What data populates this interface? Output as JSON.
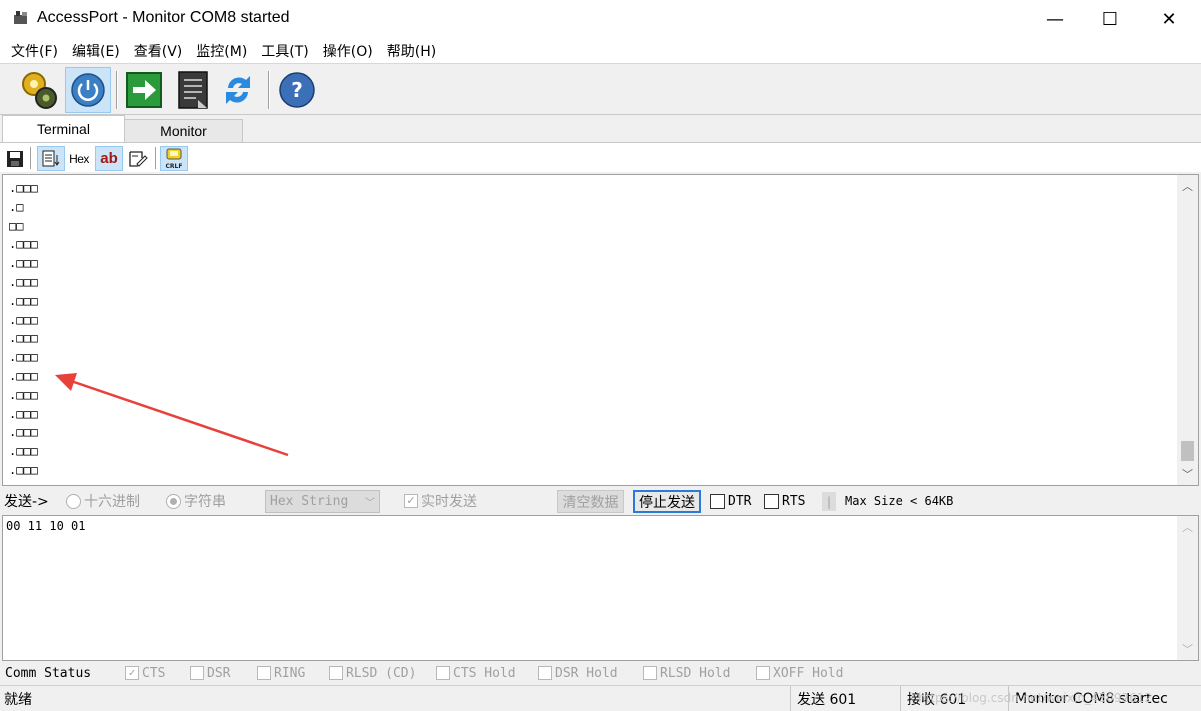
{
  "window": {
    "title": "AccessPort - Monitor COM8 started",
    "minimize_glyph": "—",
    "maximize_glyph": "☐",
    "close_glyph": "✕"
  },
  "menu": [
    "文件(F)",
    "编辑(E)",
    "查看(V)",
    "监控(M)",
    "工具(T)",
    "操作(O)",
    "帮助(H)"
  ],
  "toolbar": {
    "buttons": [
      "settings-gear-icon",
      "power-icon",
      "go-arrow-icon",
      "log-document-icon",
      "refresh-arrows-icon",
      "help-icon"
    ]
  },
  "tabs": {
    "terminal": "Terminal",
    "monitor": "Monitor"
  },
  "subtoolbar": {
    "hex_label": "Hex",
    "ab_label": "ab",
    "crlf_label": "CRLF"
  },
  "terminal": {
    "lines": [
      ".□□□",
      ".□",
      "□□",
      ".□□□",
      ".□□□",
      ".□□□",
      ".□□□",
      ".□□□",
      ".□□□",
      ".□□□",
      ".□□□",
      ".□□□",
      ".□□□",
      ".□□□",
      ".□□□",
      ".□□□"
    ]
  },
  "sendbar": {
    "label": "发送->",
    "radio_hex": "十六进制",
    "radio_string": "字符串",
    "format_select": "Hex String",
    "realtime_send": "实时发送",
    "clear_button": "清空数据",
    "stop_button": "停止发送",
    "dtr": "DTR",
    "rts": "RTS",
    "separator": "|",
    "max_size": "Max Size < 64KB"
  },
  "input": {
    "value": "00 11 10 01"
  },
  "comm_status": {
    "label": "Comm Status",
    "flags": [
      "CTS",
      "DSR",
      "RING",
      "RLSD (CD)",
      "CTS Hold",
      "DSR Hold",
      "RLSD Hold",
      "XOFF Hold"
    ]
  },
  "statusbar": {
    "ready": "就绪",
    "sent": "发送 601",
    "received": "接收 601",
    "status": "Monitor COM8 startec",
    "watermark": "https://blog.csdn.net/weixin_45092612"
  },
  "colors": {
    "arrow": "#e8403a",
    "pressed_bg": "#cce4f7"
  }
}
